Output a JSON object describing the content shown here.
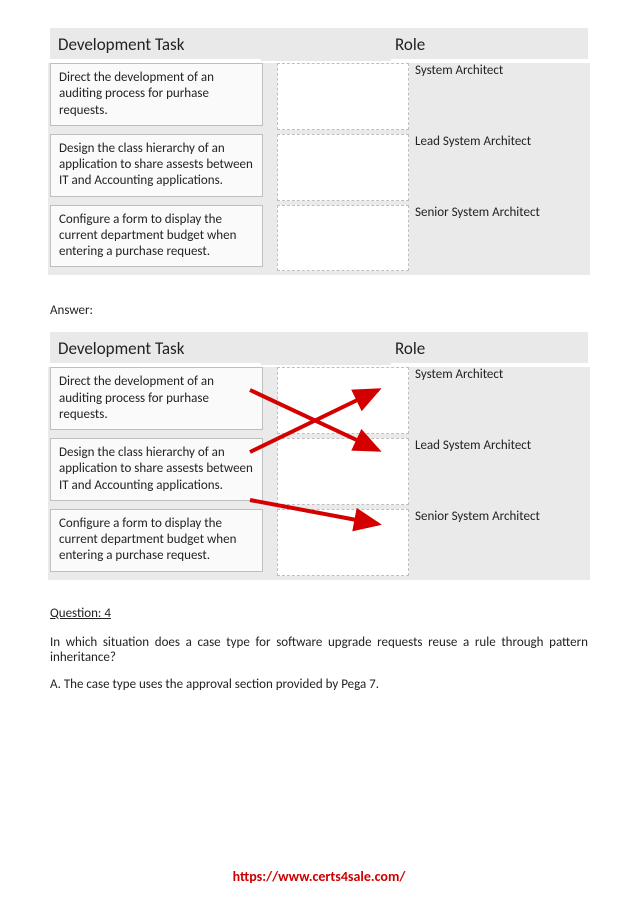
{
  "headers": {
    "dev_task": "Development Task",
    "role": "Role"
  },
  "tasks": [
    "Direct the development of an auditing process for purhase requests.",
    "Design the class hierarchy of an application to share assests between IT and Accounting applications.",
    "Configure a form to display the current department budget when entering a purchase request."
  ],
  "roles": [
    "System Architect",
    "Lead System Architect",
    "Senior System Architect"
  ],
  "answer_label": "Answer:",
  "question": {
    "label": "Question: 4",
    "text": "In which situation does a case type for software upgrade requests reuse a rule through pattern inheritance?",
    "option_a": "A. The case type uses the approval section provided by Pega 7."
  },
  "footer_url": "https://www.certs4sale.com/"
}
